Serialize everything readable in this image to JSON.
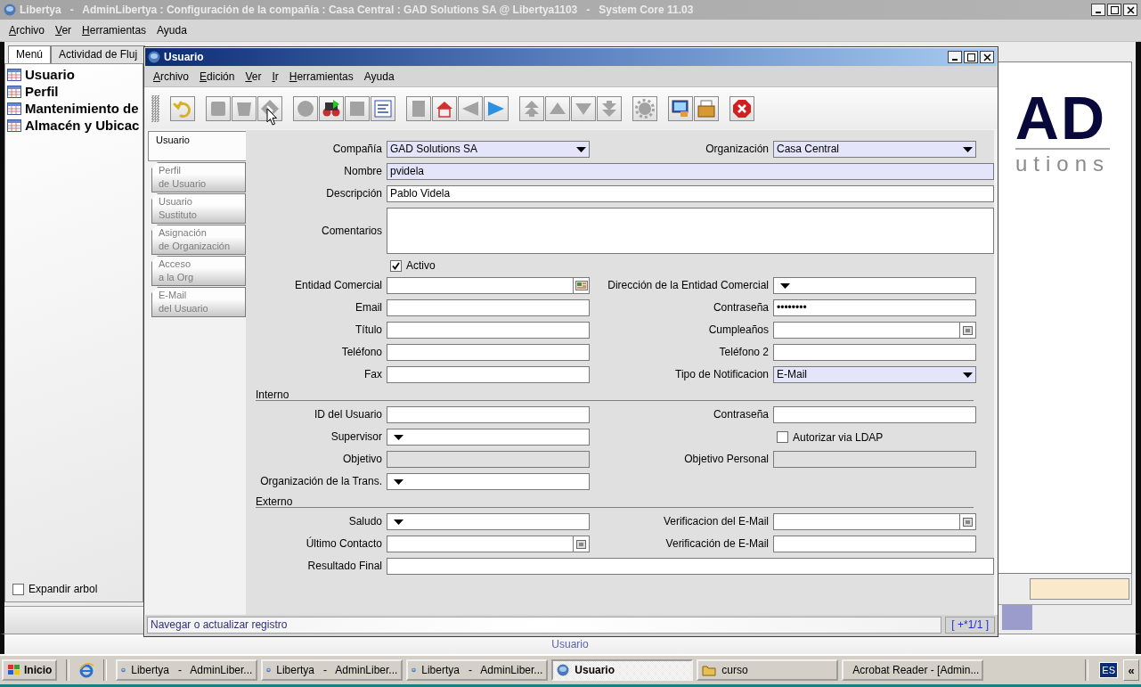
{
  "app_window": {
    "title": "Libertya   -   AdminLibertya : Configuración de la compañía : Casa Central : GAD Solutions SA @ Libertya1103   -   System Core 11.03"
  },
  "menu": [
    {
      "label": "Archivo",
      "mnemonic": true
    },
    {
      "label": "Ver",
      "mnemonic": true
    },
    {
      "label": "Herramientas",
      "mnemonic": true
    },
    {
      "label": "Ayuda",
      "mnemonic": false
    }
  ],
  "side_tabs": [
    {
      "label": "Menú",
      "selected": true
    },
    {
      "label": "Actividad de Fluj",
      "selected": false
    }
  ],
  "tree": [
    "Usuario",
    "Perfil",
    "Mantenimiento de",
    "Almacén y Ubicac"
  ],
  "expand_tree": {
    "label": "Expandir arbol",
    "checked": false
  },
  "logo": {
    "mark": "AD",
    "subtitle": "utions"
  },
  "status_bar": {
    "text": "Usuario"
  },
  "window": {
    "title": "Usuario",
    "menu": [
      {
        "label": "Archivo",
        "mnemonic": true
      },
      {
        "label": "Edición",
        "mnemonic": true
      },
      {
        "label": "Ver",
        "mnemonic": true
      },
      {
        "label": "Ir",
        "mnemonic": true
      },
      {
        "label": "Herramientas",
        "mnemonic": true
      },
      {
        "label": "Ayuda",
        "mnemonic": false
      }
    ],
    "toolbar": [
      {
        "buttons": [
          {
            "kind": "undo",
            "enabled": true
          }
        ]
      },
      {
        "buttons": [
          {
            "kind": "new",
            "enabled": false
          },
          {
            "kind": "delete",
            "enabled": false
          },
          {
            "kind": "save",
            "enabled": false
          }
        ]
      },
      {
        "buttons": [
          {
            "kind": "refresh",
            "enabled": false
          },
          {
            "kind": "find",
            "enabled": true
          },
          {
            "kind": "history",
            "enabled": false
          },
          {
            "kind": "grid",
            "enabled": true
          }
        ]
      },
      {
        "buttons": [
          {
            "kind": "parent",
            "enabled": false
          },
          {
            "kind": "home",
            "enabled": true
          },
          {
            "kind": "back",
            "enabled": false
          },
          {
            "kind": "forward",
            "enabled": true
          }
        ]
      },
      {
        "buttons": [
          {
            "kind": "first",
            "enabled": false
          },
          {
            "kind": "up",
            "enabled": false
          },
          {
            "kind": "down",
            "enabled": false
          },
          {
            "kind": "last",
            "enabled": false
          }
        ]
      },
      {
        "buttons": [
          {
            "kind": "process",
            "enabled": false
          }
        ]
      },
      {
        "buttons": [
          {
            "kind": "report",
            "enabled": true
          },
          {
            "kind": "archive",
            "enabled": true
          }
        ]
      },
      {
        "buttons": [
          {
            "kind": "exit",
            "enabled": true
          }
        ]
      }
    ],
    "tabs": [
      {
        "label": "Usuario",
        "selected": true
      },
      {
        "label": "Perfil\nde Usuario",
        "selected": false
      },
      {
        "label": "Usuario\nSustituto",
        "selected": false
      },
      {
        "label": "Asignación\nde Organización",
        "selected": false
      },
      {
        "label": "Acceso\na la Org",
        "selected": false
      },
      {
        "label": "E-Mail\ndel Usuario",
        "selected": false
      }
    ],
    "form": {
      "rows": [
        {
          "kind": "fields",
          "fields": [
            {
              "label": "Compañía",
              "kind": "combo",
              "value": "GAD Solutions SA",
              "mandatory": true
            },
            {
              "label": "Organización",
              "kind": "combo",
              "value": "Casa Central",
              "mandatory": true
            }
          ]
        },
        {
          "kind": "fields",
          "fields": [
            {
              "label": "Nombre",
              "kind": "text",
              "value": "pvidela",
              "mandatory": true,
              "wide": true
            }
          ]
        },
        {
          "kind": "fields",
          "fields": [
            {
              "label": "Descripción",
              "kind": "text",
              "value": "Pablo Videla",
              "mandatory": false,
              "wide": true
            }
          ]
        },
        {
          "kind": "fields",
          "fields": [
            {
              "label": "Comentarios",
              "kind": "textarea",
              "mandatory": false,
              "wide": true
            }
          ]
        },
        {
          "kind": "fields",
          "fields": [
            {
              "label": "Activo",
              "kind": "checkbox",
              "checked": true
            }
          ]
        },
        {
          "kind": "fields",
          "fields": [
            {
              "label": "Entidad Comercial",
              "kind": "lookup",
              "mandatory": false
            },
            {
              "label": "Dirección de la Entidad Comercial",
              "kind": "combo",
              "mandatory": false
            }
          ]
        },
        {
          "kind": "fields",
          "fields": [
            {
              "label": "Email",
              "kind": "text",
              "mandatory": false
            },
            {
              "label": "Contraseña",
              "kind": "password",
              "value": "••••••••",
              "mandatory": false
            }
          ]
        },
        {
          "kind": "fields",
          "fields": [
            {
              "label": "Título",
              "kind": "text",
              "mandatory": false
            },
            {
              "label": "Cumpleaños",
              "kind": "date",
              "mandatory": false
            }
          ]
        },
        {
          "kind": "fields",
          "fields": [
            {
              "label": "Teléfono",
              "kind": "text",
              "mandatory": false
            },
            {
              "label": "Teléfono 2",
              "kind": "text",
              "mandatory": false
            }
          ]
        },
        {
          "kind": "fields",
          "fields": [
            {
              "label": "Fax",
              "kind": "text",
              "mandatory": false
            },
            {
              "label": "Tipo de Notificacion",
              "kind": "combo",
              "value": "E-Mail",
              "mandatory": true
            }
          ]
        },
        {
          "kind": "section",
          "title": "Interno"
        },
        {
          "kind": "fields",
          "fields": [
            {
              "label": "ID del Usuario",
              "kind": "text",
              "mandatory": false
            },
            {
              "label": "Contraseña",
              "kind": "text",
              "mandatory": false
            }
          ]
        },
        {
          "kind": "fields",
          "fields": [
            {
              "label": "Supervisor",
              "kind": "combo",
              "mandatory": false
            },
            {
              "label": "Autorizar via LDAP",
              "kind": "checkbox",
              "checked": false
            }
          ]
        },
        {
          "kind": "fields",
          "fields": [
            {
              "label": "Objetivo",
              "kind": "readonly"
            },
            {
              "label": "Objetivo Personal",
              "kind": "readonly"
            }
          ]
        },
        {
          "kind": "fields",
          "fields": [
            {
              "label": "Organización de la Trans.",
              "kind": "combo",
              "mandatory": false
            }
          ]
        },
        {
          "kind": "section",
          "title": "Externo"
        },
        {
          "kind": "fields",
          "fields": [
            {
              "label": "Saludo",
              "kind": "combo",
              "mandatory": false
            },
            {
              "label": "Verificacion del E-Mail",
              "kind": "date",
              "mandatory": false
            }
          ]
        },
        {
          "kind": "fields",
          "fields": [
            {
              "label": "Último Contacto",
              "kind": "date",
              "mandatory": false
            },
            {
              "label": "Verificación de E-Mail",
              "kind": "text",
              "mandatory": false
            }
          ]
        },
        {
          "kind": "fields",
          "fields": [
            {
              "label": "Resultado Final",
              "kind": "text",
              "mandatory": false,
              "wide": true
            }
          ]
        }
      ]
    },
    "status": {
      "message": "Navegar o actualizar registro",
      "record": "[ +*1/1 ]"
    }
  },
  "taskbar": {
    "start": "Inicio",
    "tasks": [
      {
        "label": "Libertya   -   AdminLiber...",
        "kind": "app",
        "selected": false
      },
      {
        "label": "Libertya   -   AdminLiber...",
        "kind": "app",
        "selected": false
      },
      {
        "label": "Libertya   -   AdminLiber...",
        "kind": "app",
        "selected": false
      },
      {
        "label": "Usuario",
        "kind": "app",
        "selected": true
      },
      {
        "label": "curso",
        "kind": "folder",
        "selected": false
      },
      {
        "label": "Acrobat Reader - [Admin...",
        "kind": "pdf",
        "selected": false
      }
    ],
    "language": "ES",
    "collapse": "«"
  }
}
